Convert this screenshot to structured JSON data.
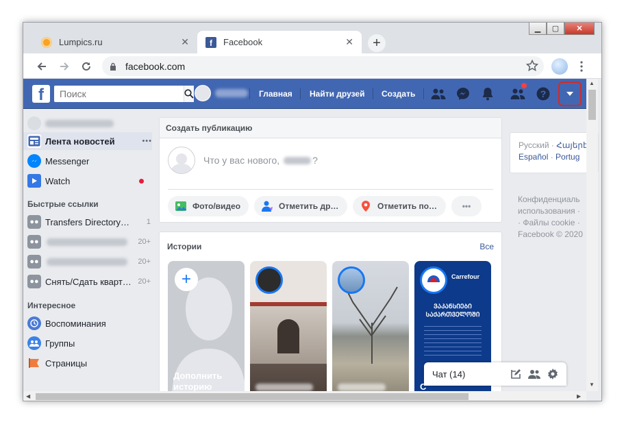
{
  "browser": {
    "tabs": [
      {
        "title": "Lumpics.ru",
        "favicon_color": "#f7a325",
        "active": false
      },
      {
        "title": "Facebook",
        "favicon_color": "#3b5998",
        "active": true
      }
    ],
    "tab_close": "✕",
    "new_tab": "+",
    "url": "facebook.com",
    "window_controls": {
      "minimize": "▁",
      "maximize": "▢",
      "close": "✕"
    }
  },
  "fb": {
    "logo": "f",
    "search_placeholder": "Поиск",
    "nav": {
      "home": "Главная",
      "find_friends": "Найти друзей",
      "create": "Создать"
    },
    "brand_color": "#4267b2",
    "highlight_color": "#d12b2b"
  },
  "left_sidebar": {
    "items": [
      {
        "label": "Лента новостей",
        "more": "•••",
        "icon": "news-feed-icon"
      },
      {
        "label": "Messenger",
        "icon": "messenger-icon"
      },
      {
        "label": "Watch",
        "icon": "watch-icon"
      }
    ],
    "quick_links_title": "Быстрые ссылки",
    "quick_links": [
      {
        "label": "Transfers Directory…",
        "count": "1"
      },
      {
        "label": "",
        "count": "20+"
      },
      {
        "label": "",
        "count": "20+"
      },
      {
        "label": "Снять/Сдать кварт…",
        "count": "20+"
      }
    ],
    "interesting_title": "Интересное",
    "interesting": [
      {
        "label": "Воспоминания",
        "icon": "memories-icon"
      },
      {
        "label": "Группы",
        "icon": "groups-icon"
      },
      {
        "label": "Страницы",
        "icon": "pages-icon"
      }
    ]
  },
  "composer": {
    "header": "Создать публикацию",
    "prompt_prefix": "Что у вас нового,",
    "prompt_suffix": "?",
    "actions": [
      {
        "label": "Фото/видео",
        "icon": "photo-video-icon"
      },
      {
        "label": "Отметить др…",
        "icon": "tag-friends-icon"
      },
      {
        "label": "Отметить по…",
        "icon": "check-in-icon"
      },
      {
        "label": "•••",
        "icon": "more-icon"
      }
    ]
  },
  "stories": {
    "title": "Истории",
    "see_all": "Все",
    "add_label": "Дополнить историю",
    "card3_text": "ᲕᲐᲙᲐᲜᲡᲘᲔᲑᲘ ᲡᲐᲥᲐᲠᲗᲕᲔᲚᲝᲨᲘ",
    "card3_brand": "Carrefour",
    "card3_caption": "С"
  },
  "right_column": {
    "lang_current": "Русский",
    "lang_links": [
      "Հայերէ",
      "Español",
      "Portug"
    ],
    "footer_lines": [
      "Конфиденциаль",
      "использования ·",
      "· Файлы cookie ·",
      "Facebook © 2020"
    ]
  },
  "chat": {
    "label": "Чат (14)"
  }
}
